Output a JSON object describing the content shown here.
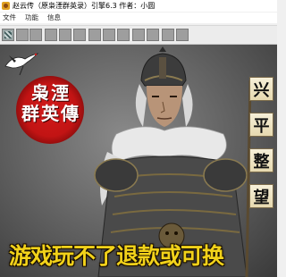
{
  "window": {
    "title": "赵云传（原枭湮群英录）引擎6.3 作者：小圆"
  },
  "menu": {
    "items": [
      "文件",
      "功能",
      "信息"
    ]
  },
  "toolbar": {
    "button_count": 13
  },
  "content": {
    "seal_line1": "枭湮",
    "seal_line2": "群英傳",
    "side_buttons": [
      "兴",
      "平",
      "整",
      "望"
    ],
    "banner": "游戏玩不了退款或可换"
  },
  "colors": {
    "seal_red": "#c21414",
    "banner_yellow": "#f2d21a",
    "titlebar_bg": "#ffffff",
    "toolbar_bg": "#ececec"
  }
}
